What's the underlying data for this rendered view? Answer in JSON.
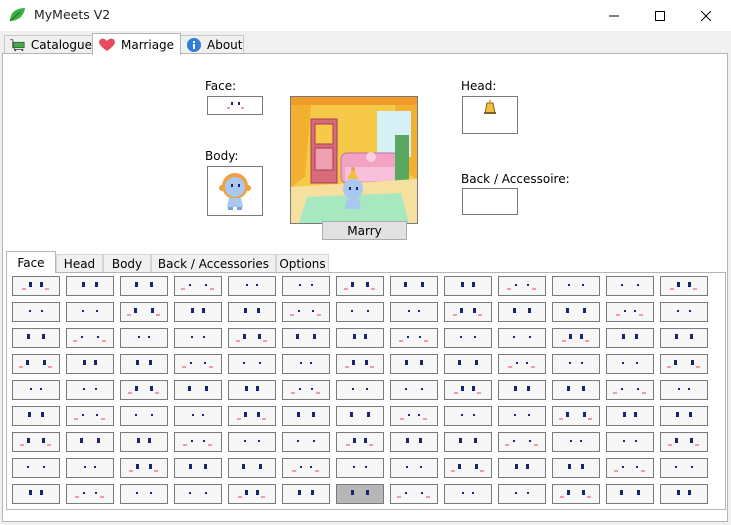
{
  "window": {
    "title": "MyMeets V2",
    "icon": "leaf-icon"
  },
  "tabs": [
    {
      "label": "Catalogue",
      "icon": "cart-icon"
    },
    {
      "label": "Marriage",
      "icon": "heart-icon",
      "selected": true
    },
    {
      "label": "About",
      "icon": "info-icon"
    }
  ],
  "marriage": {
    "face_label": "Face:",
    "body_label": "Body:",
    "head_label": "Head:",
    "back_label": "Back / Accessoire:",
    "marry_button": "Marry",
    "colors": {
      "wall": "#f6c948",
      "window": "#f09a2b",
      "sofa": "#f2a3c4",
      "floor": "#a8e8c0",
      "cabinet": "#d86a7a"
    }
  },
  "sub_tabs": [
    {
      "label": "Face",
      "selected": true
    },
    {
      "label": "Head"
    },
    {
      "label": "Body"
    },
    {
      "label": "Back / Accessories"
    },
    {
      "label": "Options"
    }
  ],
  "face_grid": {
    "rows": 9,
    "columns": 13,
    "selected_index": 110,
    "eye_color": "#1a2570",
    "blush_color": "#f39ab0"
  }
}
